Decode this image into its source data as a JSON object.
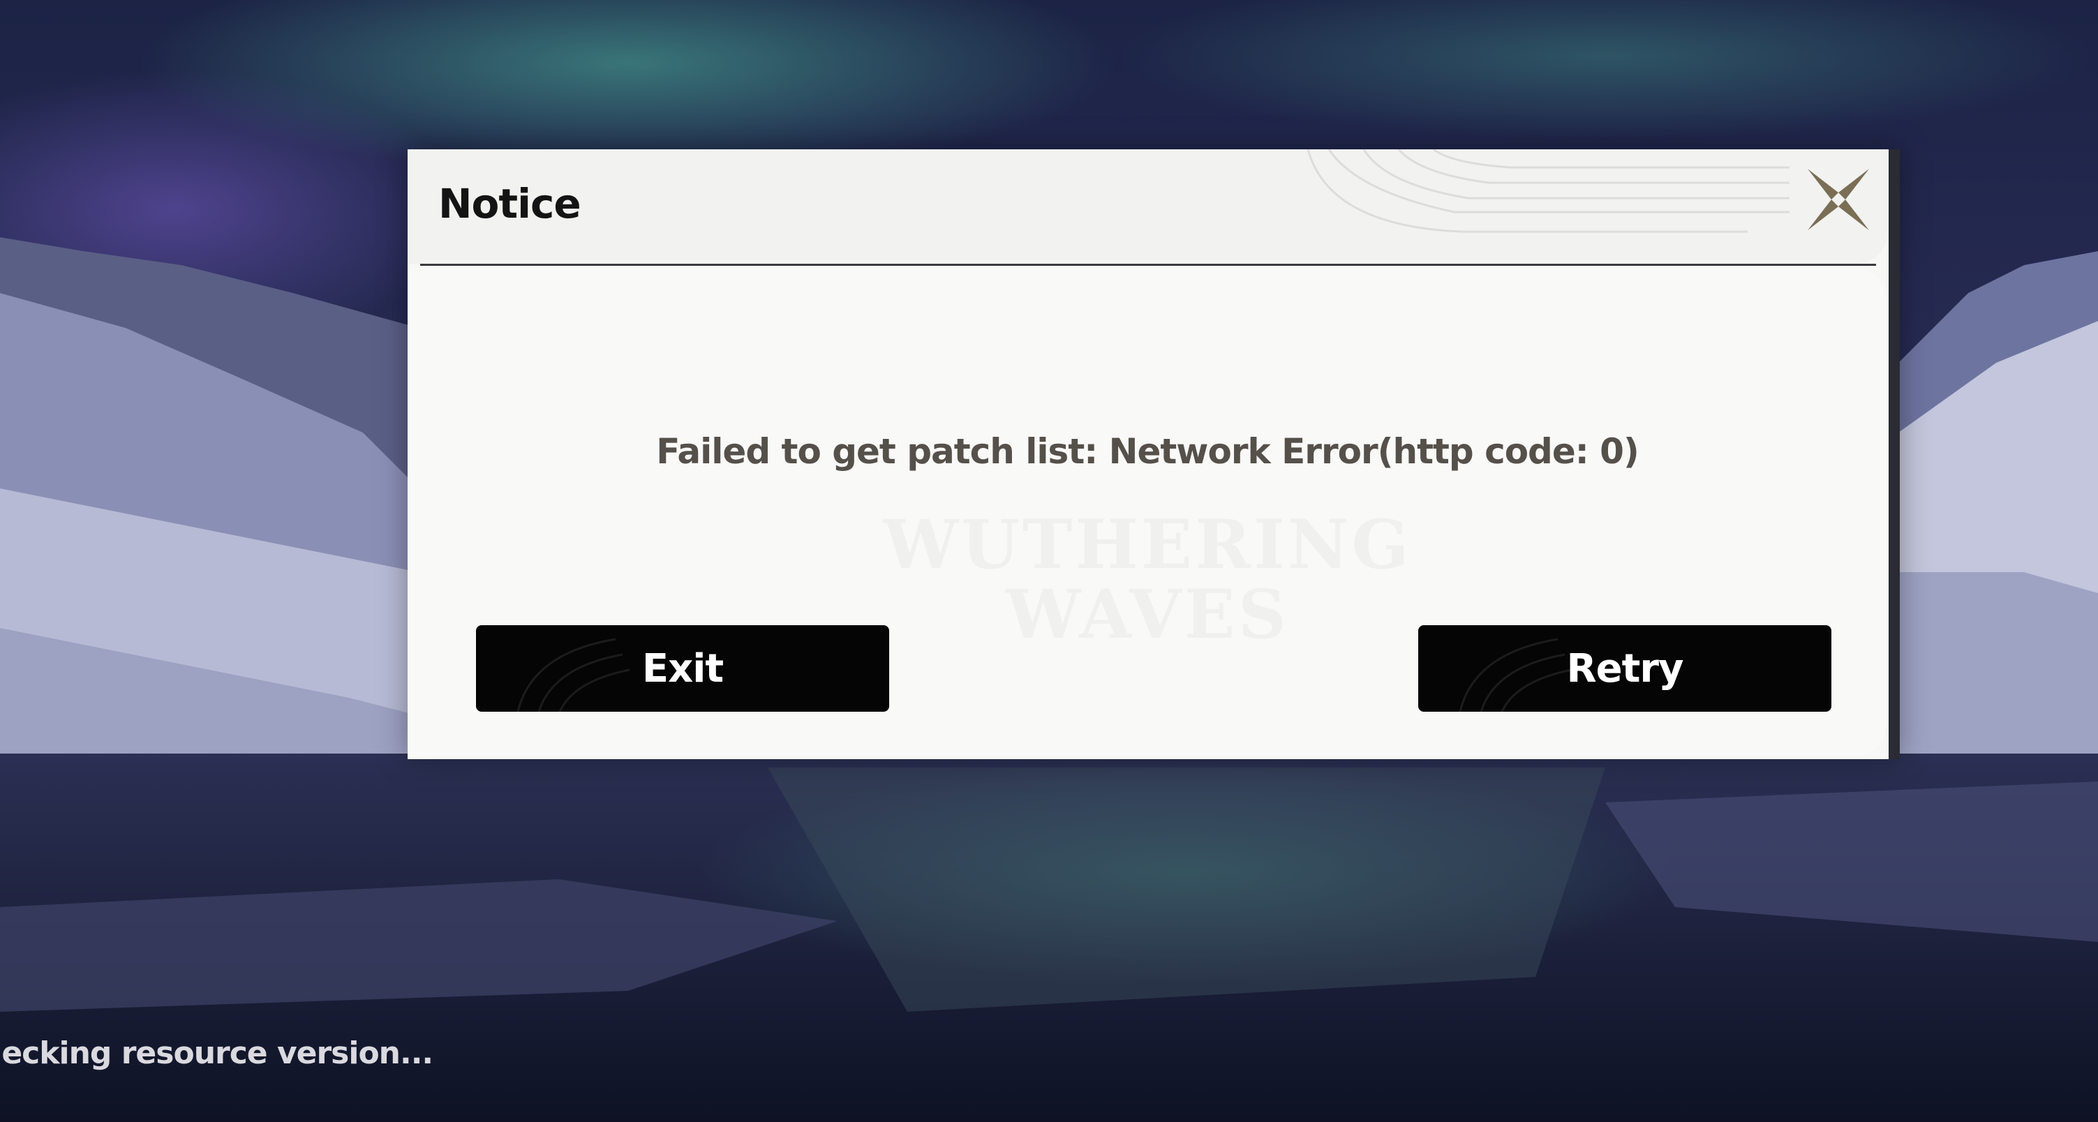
{
  "dialog": {
    "title": "Notice",
    "message": "Failed to get patch list: Network Error(http code: 0)",
    "watermark_line1": "WUTHERING",
    "watermark_line2": "WAVES",
    "buttons": {
      "exit_label": "Exit",
      "retry_label": "Retry"
    },
    "close_icon": "close-x-icon"
  },
  "status": {
    "text": "hecking resource version..."
  },
  "colors": {
    "dialog_bg": "#f7f7f6",
    "button_bg": "#050505",
    "button_text": "#ffffff",
    "message_text": "#55504a",
    "close_icon": "#7a6e55"
  }
}
